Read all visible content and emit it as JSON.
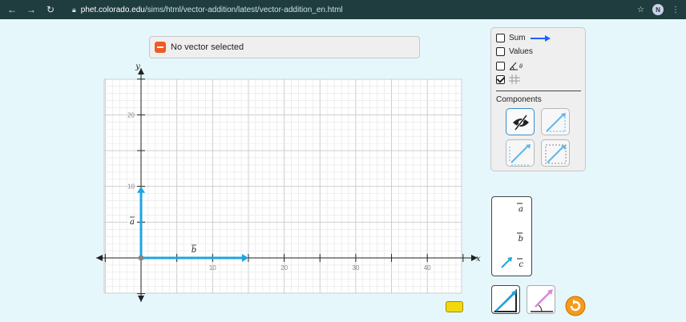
{
  "browser": {
    "url_host": "phet.colorado.edu",
    "url_path": "/sims/html/vector-addition/latest/vector-addition_en.html",
    "avatar_letter": "N"
  },
  "vector_selector": {
    "label": "No vector selected"
  },
  "options_panel": {
    "sum_label": "Sum",
    "values_label": "Values",
    "sum_checked": false,
    "values_checked": false,
    "angle_checked": false,
    "grid_checked": true,
    "components_title": "Components",
    "sum_color": "#1c62ff"
  },
  "graph": {
    "x_axis_label": "x",
    "y_axis_label": "y",
    "x_ticks": [
      "10",
      "20",
      "30",
      "40"
    ],
    "y_ticks": [
      "10",
      "20"
    ],
    "vector_a": {
      "label": "a",
      "start": [
        0,
        0
      ],
      "end": [
        0,
        10
      ],
      "color": "#1fa4e0"
    },
    "vector_b": {
      "label": "b",
      "start": [
        0,
        0
      ],
      "end": [
        15,
        0
      ],
      "color": "#1fa4e0"
    }
  },
  "legend": {
    "items": [
      "a",
      "b",
      "c"
    ]
  },
  "icons": {
    "back": "back-arrow-icon",
    "forward": "forward-arrow-icon",
    "reload": "reload-icon",
    "star": "star-icon",
    "menu": "kebab-menu-icon"
  }
}
